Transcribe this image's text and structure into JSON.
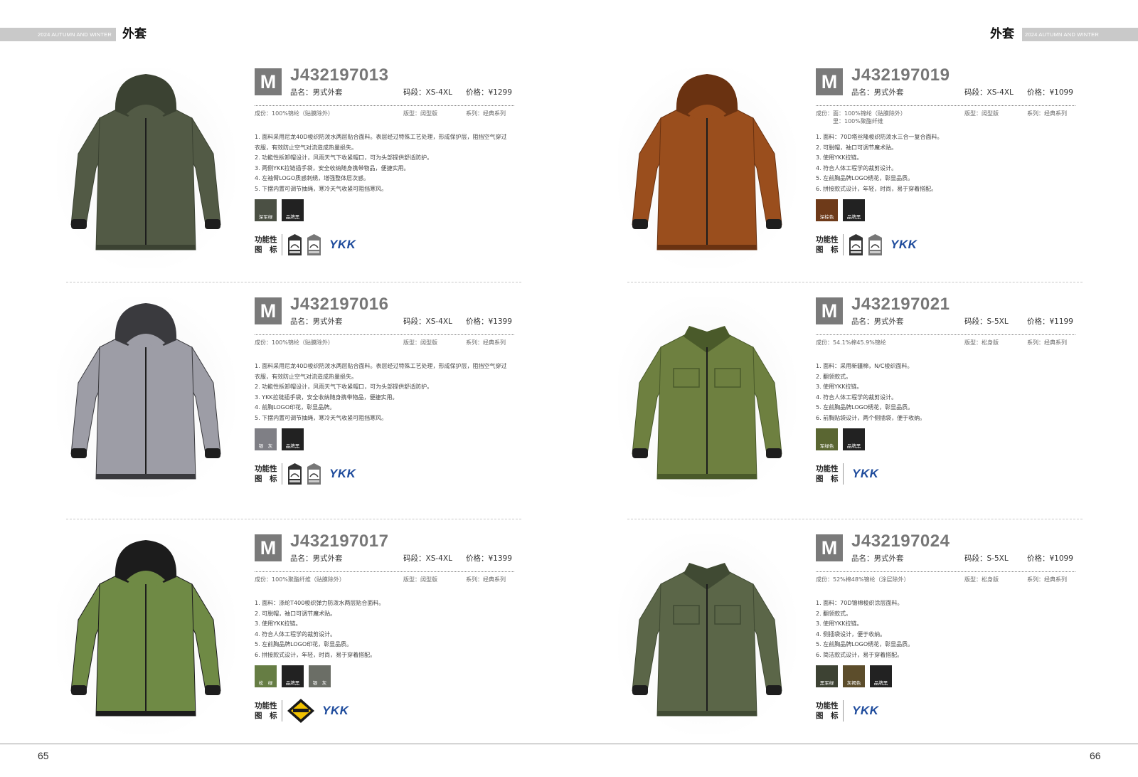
{
  "pages": [
    {
      "header_band": "2024 AUTUMN AND WINTER",
      "header_title": "外套",
      "page_number": "65",
      "products": [
        {
          "badge": "M",
          "code": "J432197013",
          "name": "品名：男式外套",
          "size": "码段：XS-4XL",
          "price": "价格：¥1299",
          "composition": [
            "成份：100%锦纶（贴膜除外）"
          ],
          "fit": "版型：阔型版",
          "series": "系列：经典系列",
          "features": [
            "1. 面料采用尼龙40D梭织防泼水两层贴合面料。表层经过特殊工艺处理，形成保护层，阻挡空气穿过",
            "    衣服，有效防止空气对流造成热量损失。",
            "2. 功能性拆卸帽设计，风雨天气下收紧帽口，可为头部提供舒适防护。",
            "3. 两侧YKK拉链插手袋，安全收纳随身携带物品，便捷实用。",
            "4. 左袖臂LOGO质感刺绣，增强整体层次感。",
            "5. 下摆内置可调节抽绳，寒冷天气收紧可阻挡寒风。"
          ],
          "colors": [
            {
              "label": "深军绿",
              "hex": "#4b5044"
            },
            {
              "label": "品牌黑",
              "hex": "#222222"
            }
          ],
          "function_label_1": "功能性",
          "function_label_2": "图　标",
          "function_icons": [
            "windproof-tag-icon",
            "warm-tag-icon"
          ],
          "zipper_brand": "YKK",
          "jacket": {
            "body": "#525a45",
            "trim": "#3b4232",
            "hood": true,
            "collar": "hood"
          }
        },
        {
          "badge": "M",
          "code": "J432197016",
          "name": "品名：男式外套",
          "size": "码段：XS-4XL",
          "price": "价格：¥1399",
          "composition": [
            "成份：100%锦纶（贴膜除外）"
          ],
          "fit": "版型：阔型版",
          "series": "系列：经典系列",
          "features": [
            "1. 面料采用尼龙40D梭织防泼水两层贴合面料。表层经过特殊工艺处理，形成保护层，阻挡空气穿过",
            "    衣服，有效防止空气对流造成热量损失。",
            "2. 功能性拆卸帽设计，风雨天气下收紧帽口，可为头部提供舒适防护。",
            "3. YKK拉链插手袋，安全收纳随身携带物品，便捷实用。",
            "4. 前胸LOGO印花，彰显品牌。",
            "5. 下摆内置可调节抽绳，寒冷天气收紧可阻挡寒风。"
          ],
          "colors": [
            {
              "label": "银　灰",
              "hex": "#7f7f85"
            },
            {
              "label": "品牌黑",
              "hex": "#222222"
            }
          ],
          "function_label_1": "功能性",
          "function_label_2": "图　标",
          "function_icons": [
            "windproof-tag-icon",
            "warm-tag-icon"
          ],
          "zipper_brand": "YKK",
          "jacket": {
            "body": "#9d9da6",
            "trim": "#3a3a3e",
            "hood": true,
            "collar": "hood"
          }
        },
        {
          "badge": "M",
          "code": "J432197017",
          "name": "品名：男式外套",
          "size": "码段：XS-4XL",
          "price": "价格：¥1399",
          "composition": [
            "成份：100%聚酯纤维（贴膜除外）"
          ],
          "fit": "版型：阔型版",
          "series": "系列：经典系列",
          "features": [
            "1. 面料：涤纶T400梭织弹力防泼水两层贴合面料。",
            "2. 可脱帽，袖口可调节魔术贴。",
            "3. 使用YKK拉链。",
            "4. 符合人体工程学的裁剪设计。",
            "5. 左前胸品牌LOGO印花，彰显品质。",
            "6. 拼接款式设计，年轻，时尚，易于穿着搭配。"
          ],
          "colors": [
            {
              "label": "松　绿",
              "hex": "#667d44"
            },
            {
              "label": "品牌黑",
              "hex": "#222222"
            },
            {
              "label": "银　灰",
              "hex": "#6b6e66"
            }
          ],
          "function_label_1": "功能性",
          "function_label_2": "图　标",
          "function_icons": [
            "diamond-badge-icon"
          ],
          "zipper_brand": "YKK",
          "jacket": {
            "body": "#6f8a45",
            "trim": "#1c1c1c",
            "hood": true,
            "collar": "hood"
          }
        }
      ]
    },
    {
      "header_band": "2024 AUTUMN AND WINTER",
      "header_title": "外套",
      "page_number": "66",
      "products": [
        {
          "badge": "M",
          "code": "J432197019",
          "name": "品名：男式外套",
          "size": "码段：XS-4XL",
          "price": "价格：¥1099",
          "composition": [
            "成份：面：100%锦纶（贴膜除外）",
            "　　　里：100%聚酯纤维"
          ],
          "fit": "版型：阔型版",
          "series": "系列：经典系列",
          "features": [
            "1. 面料：70D塔丝隆梭织防泼水三合一复合面料。",
            "2. 可脱帽，袖口可调节魔术贴。",
            "3. 使用YKK拉链。",
            "4. 符合人体工程学的裁剪设计。",
            "5. 左前胸品牌LOGO绣花，彰显品质。",
            "6. 拼接款式设计，年轻，时尚，易于穿着搭配。"
          ],
          "colors": [
            {
              "label": "深棕色",
              "hex": "#6e3a19"
            },
            {
              "label": "品牌黑",
              "hex": "#222222"
            }
          ],
          "function_label_1": "功能性",
          "function_label_2": "图　标",
          "function_icons": [
            "windproof-tag-icon",
            "warm-tag-icon"
          ],
          "zipper_brand": "YKK",
          "jacket": {
            "body": "#9a4e1d",
            "trim": "#6a3211",
            "hood": true,
            "collar": "hood"
          }
        },
        {
          "badge": "M",
          "code": "J432197021",
          "name": "品名：男式外套",
          "size": "码段：S-5XL",
          "price": "价格：¥1199",
          "composition": [
            "成份：54.1%棉45.9%锦纶"
          ],
          "fit": "版型：松身版",
          "series": "系列：经典系列",
          "features": [
            "1. 面料：采用新疆棉，N/C梭织面料。",
            "2. 翻领款式。",
            "3. 使用YKK拉链。",
            "4. 符合人体工程学的裁剪设计。",
            "5. 左前胸品牌LOGO绣花，彰显品质。",
            "6. 前胸贴袋设计，两个侧插袋，便于收纳。"
          ],
          "colors": [
            {
              "label": "军绿色",
              "hex": "#5a6632"
            },
            {
              "label": "品牌黑",
              "hex": "#222222"
            }
          ],
          "function_label_1": "功能性",
          "function_label_2": "图　标",
          "function_icons": [],
          "zipper_brand": "YKK",
          "jacket": {
            "body": "#6e8040",
            "trim": "#4a5a2a",
            "hood": false,
            "collar": "shirt"
          }
        },
        {
          "badge": "M",
          "code": "J432197024",
          "name": "品名：男式外套",
          "size": "码段：S-5XL",
          "price": "价格：¥1099",
          "composition": [
            "成份：52%棉48%锦纶（涂层除外）"
          ],
          "fit": "版型：松身版",
          "series": "系列：经典系列",
          "features": [
            "1. 面料：70D锦棉梭织涂层面料。",
            "2. 翻领款式。",
            "3. 使用YKK拉链。",
            "4. 侧插袋设计，便于收纳。",
            "5. 左前胸品牌LOGO绣花，彰显品质。",
            "6. 简洁款式设计，易于穿着搭配。"
          ],
          "colors": [
            {
              "label": "黑军绿",
              "hex": "#3d4233"
            },
            {
              "label": "灰褐色",
              "hex": "#5c4d2b"
            },
            {
              "label": "品牌黑",
              "hex": "#222222"
            }
          ],
          "function_label_1": "功能性",
          "function_label_2": "图　标",
          "function_icons": [],
          "zipper_brand": "YKK",
          "jacket": {
            "body": "#5b6648",
            "trim": "#404a33",
            "hood": false,
            "collar": "shirt"
          }
        }
      ]
    }
  ]
}
